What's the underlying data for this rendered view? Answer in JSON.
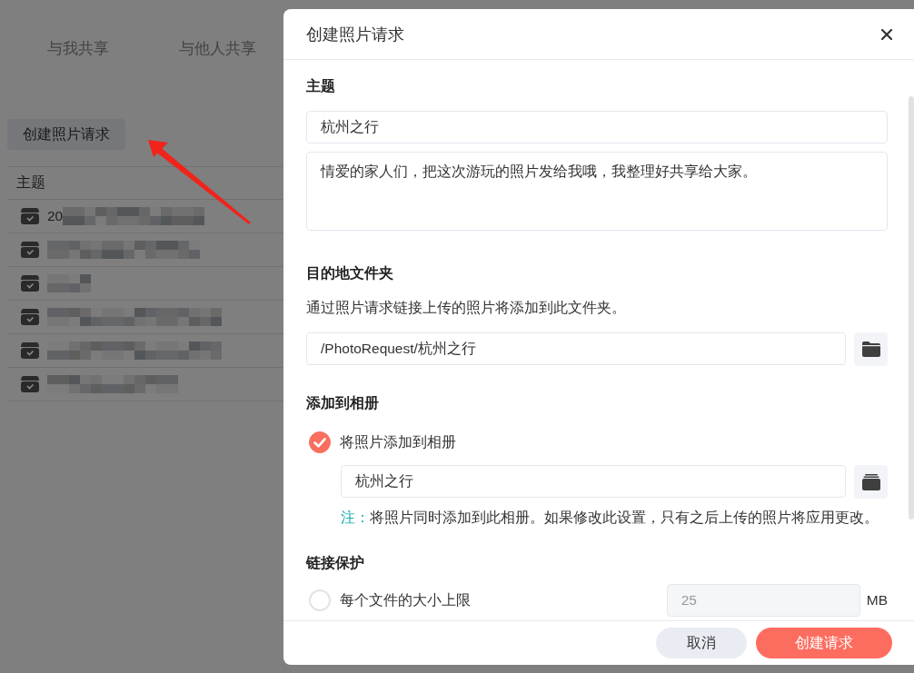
{
  "page": {
    "tabs": [
      {
        "label": "与我共享",
        "selected": false
      },
      {
        "label": "与他人共享",
        "selected": false
      }
    ],
    "create_button": "创建照片请求",
    "table": {
      "columns": [
        "主题"
      ],
      "rows": [
        {
          "text": "20",
          "redacted": true
        },
        {
          "redacted": true
        },
        {
          "redacted": true
        },
        {
          "redacted": true
        },
        {
          "redacted": true
        },
        {
          "redacted": true
        }
      ]
    }
  },
  "dialog": {
    "title": "创建照片请求",
    "subject": {
      "heading": "主题",
      "title_value": "杭州之行",
      "message_value": "情爱的家人们，把这次游玩的照片发给我哦，我整理好共享给大家。"
    },
    "destination": {
      "heading": "目的地文件夹",
      "description": "通过照片请求链接上传的照片将添加到此文件夹。",
      "path_value": "/PhotoRequest/杭州之行"
    },
    "album": {
      "heading": "添加到相册",
      "option": {
        "label": "将照片添加到相册",
        "checked": true
      },
      "album_value": "杭州之行",
      "note_label": "注：",
      "note": "将照片同时添加到此相册。如果修改此设置，只有之后上传的照片将应用更改。"
    },
    "protection": {
      "heading": "链接保护",
      "options": [
        {
          "label": "每个文件的大小上限",
          "checked": false,
          "value": "25",
          "unit": "MB",
          "disabled": true
        }
      ]
    },
    "buttons": [
      {
        "label": "取消",
        "kind": "secondary"
      },
      {
        "label": "创建请求",
        "kind": "primary"
      }
    ]
  }
}
